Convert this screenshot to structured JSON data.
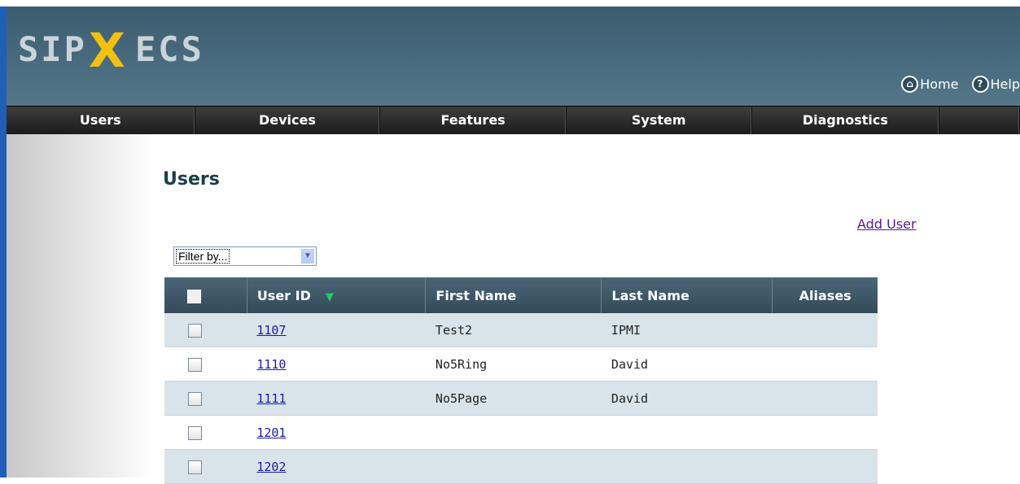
{
  "header": {
    "logo_part1": "SIP",
    "logo_x": "X",
    "logo_part2": "ECS",
    "home_label": "Home",
    "help_label": "Help"
  },
  "nav": {
    "items": [
      "Users",
      "Devices",
      "Features",
      "System",
      "Diagnostics"
    ]
  },
  "page": {
    "title": "Users",
    "add_user": "Add User",
    "filter_value": "Filter by..."
  },
  "table": {
    "columns": [
      "User ID",
      "First Name",
      "Last Name",
      "Aliases"
    ],
    "sorted_column": "User ID",
    "sort_direction": "descending",
    "rows": [
      {
        "user_id": "1107",
        "first_name": "Test2",
        "last_name": "IPMI",
        "aliases": ""
      },
      {
        "user_id": "1110",
        "first_name": "No5Ring",
        "last_name": "David",
        "aliases": ""
      },
      {
        "user_id": "1111",
        "first_name": "No5Page",
        "last_name": "David",
        "aliases": ""
      },
      {
        "user_id": "1201",
        "first_name": "",
        "last_name": "",
        "aliases": ""
      },
      {
        "user_id": "1202",
        "first_name": "",
        "last_name": "",
        "aliases": ""
      }
    ]
  },
  "colors": {
    "header_bg": "#4a6c80",
    "nav_bg": "#2a2a2a",
    "logo_accent": "#f2c10d",
    "row_alt": "#d9e4ea",
    "link": "#1a1aa8"
  }
}
